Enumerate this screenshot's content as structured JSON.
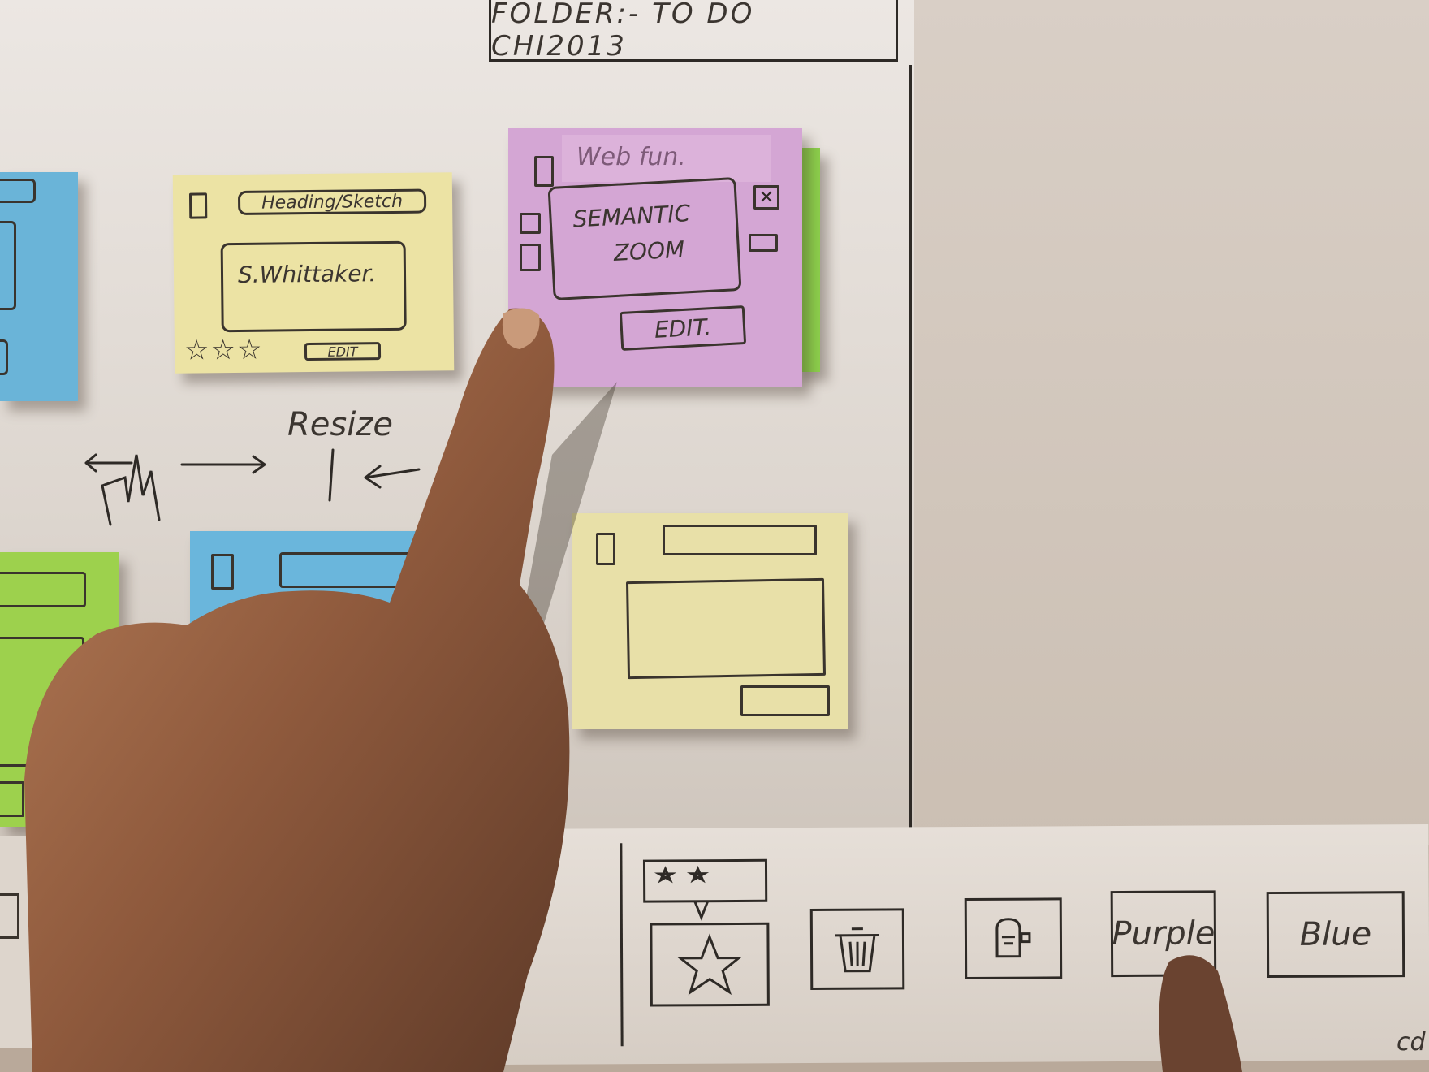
{
  "folder": {
    "title": "FOLDER:- TO DO CHI2013"
  },
  "yellow_note": {
    "heading": "Heading/Sketch",
    "author": "S.Whittaker.",
    "edit_label": "EDIT",
    "rating_stars": 3
  },
  "purple_note": {
    "title": "Web fun.",
    "body": [
      "SEMANTIC",
      "ZOOM"
    ],
    "edit_label": "EDIT."
  },
  "gesture": {
    "label": "Resize"
  },
  "toolbar": {
    "buttons": [
      {
        "icon": "star-rating-icon"
      },
      {
        "icon": "trash-bin-icon"
      },
      {
        "icon": "archive-icon"
      },
      {
        "label": "Purple"
      },
      {
        "label": "Blue"
      }
    ]
  },
  "credit": {
    "text": "cd"
  },
  "colors": {
    "yellow": "#ece3a4",
    "purple": "#d4a6d4",
    "blue": "#6ab4d8",
    "green": "#9dd14d"
  }
}
